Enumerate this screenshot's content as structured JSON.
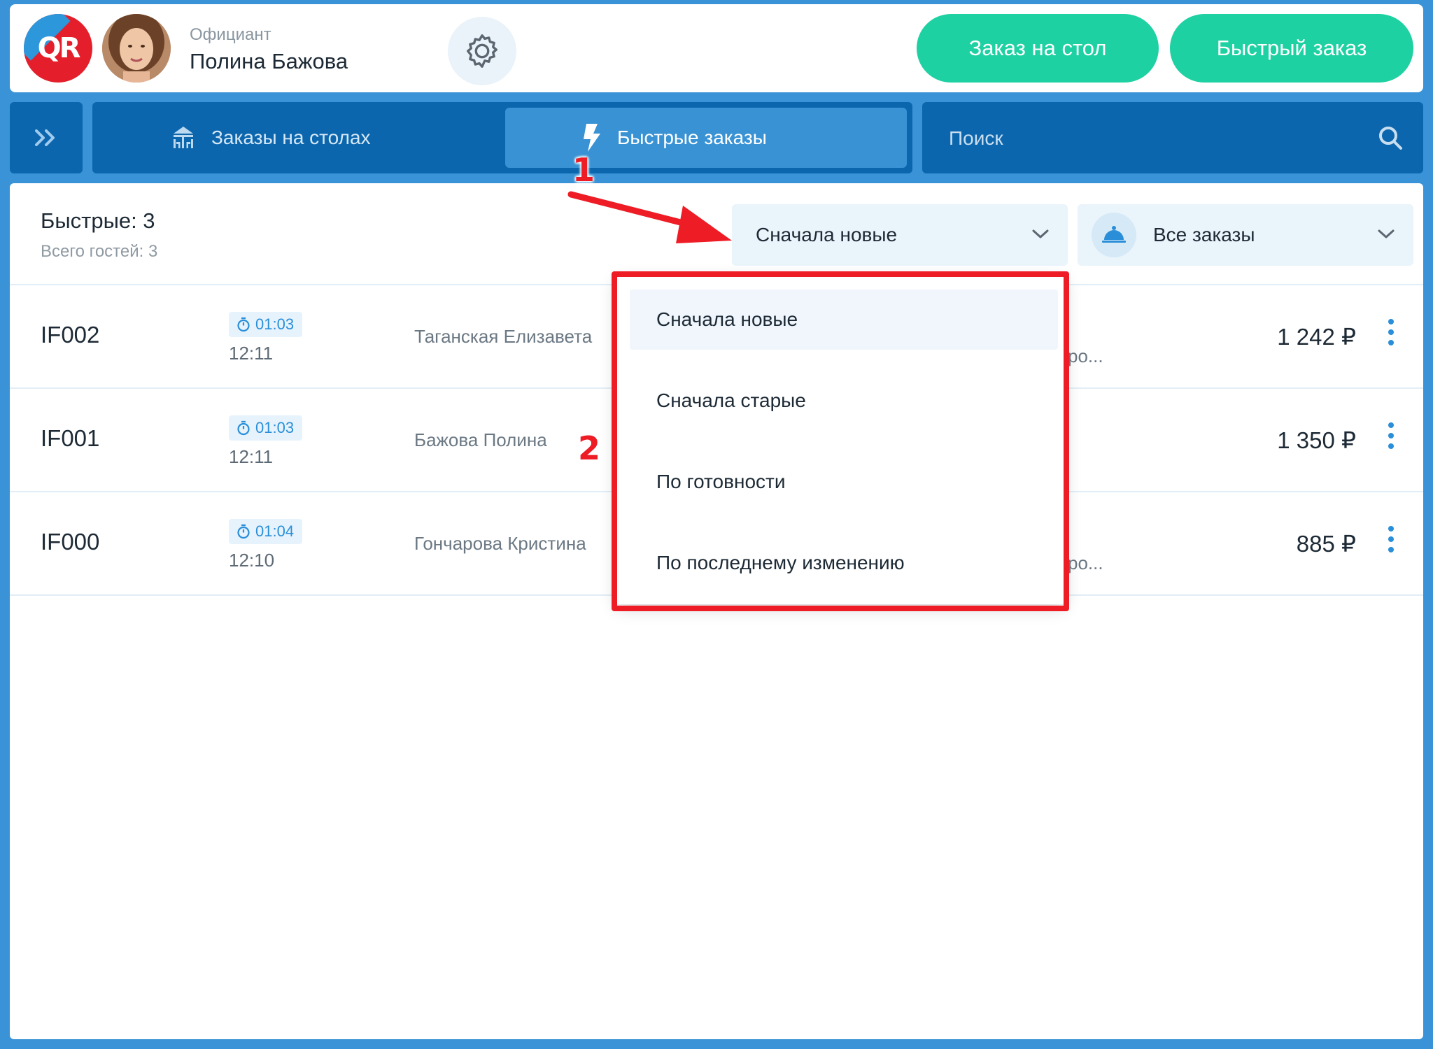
{
  "header": {
    "logo_text": "QR",
    "role_label": "Официант",
    "user_name": "Полина Бажова",
    "btn_table_order": "Заказ на стол",
    "btn_fast_order": "Быстрый заказ"
  },
  "nav": {
    "tabs": [
      {
        "label": "Заказы на столах",
        "icon": "table-icon",
        "active": false
      },
      {
        "label": "Быстрые заказы",
        "icon": "lightning-icon",
        "active": true
      }
    ],
    "search_placeholder": "Поиск"
  },
  "summary": {
    "title": "Быстрые: 3",
    "subtitle": "Всего гостей: 3"
  },
  "sort": {
    "selected": "Сначала новые",
    "options": [
      "Сначала новые",
      "Сначала старые",
      "По готовности",
      "По последнему изменению"
    ]
  },
  "filter": {
    "selected": "Все заказы",
    "icon": "cloche-icon"
  },
  "orders": [
    {
      "id": "IF002",
      "timer": "01:03",
      "time": "12:11",
      "guest": "Таганская Елизавета",
      "trunc": "ро...",
      "amount": "1 242 ₽"
    },
    {
      "id": "IF001",
      "timer": "01:03",
      "time": "12:11",
      "guest": "Бажова Полина",
      "trunc": "",
      "amount": "1 350 ₽"
    },
    {
      "id": "IF000",
      "timer": "01:04",
      "time": "12:10",
      "guest": "Гончарова Кристина",
      "trunc": "ро...",
      "amount": "885 ₽"
    }
  ],
  "annotations": {
    "step1": "1",
    "step2": "2"
  },
  "colors": {
    "background": "#3a93d6",
    "nav": "#0c66ad",
    "nav_active": "#3892d4",
    "accent_green": "#1ed1a2",
    "accent_blue": "#2a8fd8",
    "annotation_red": "#ee1c25"
  }
}
